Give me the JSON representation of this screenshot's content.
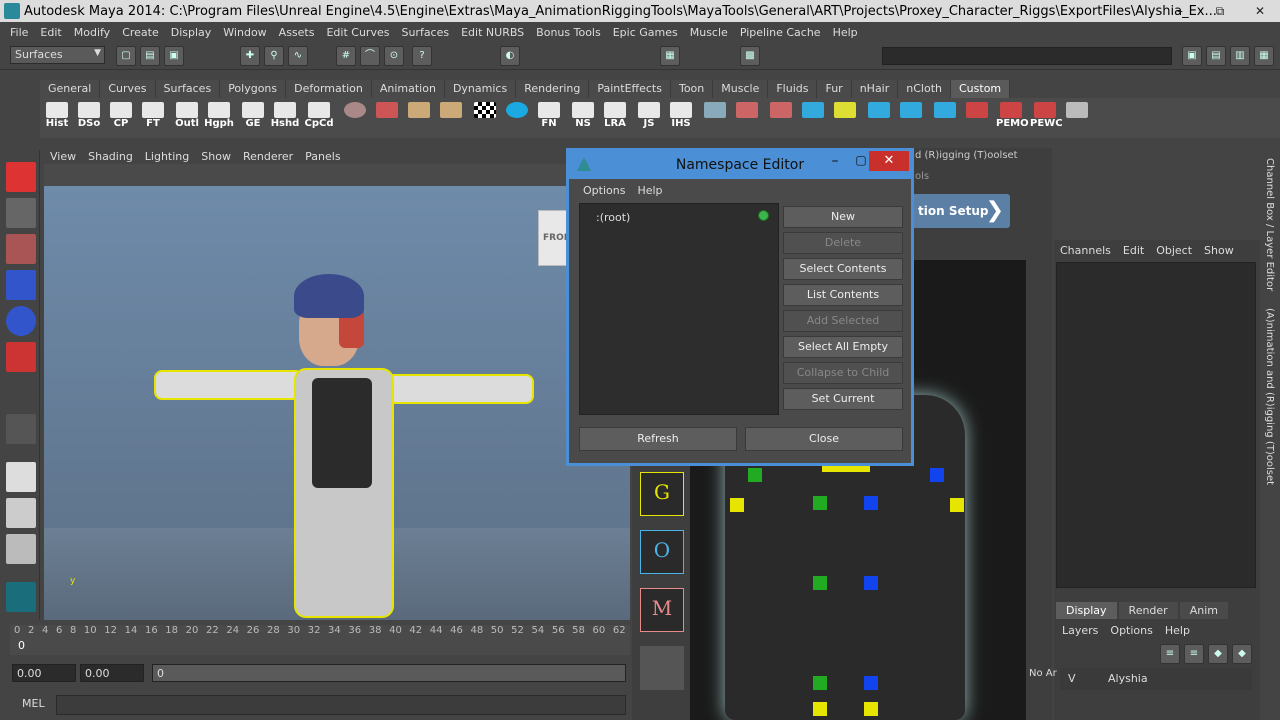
{
  "window": {
    "title": "Autodesk Maya 2014: C:\\Program Files\\Unreal Engine\\4.5\\Engine\\Extras\\Maya_AnimationRiggingTools\\MayaTools\\General\\ART\\Projects\\Proxey_Character_Riggs\\ExportFiles\\Alyshia_Ex...",
    "minimize": "–",
    "restore": "⧉",
    "close": "✕"
  },
  "menubar": [
    "File",
    "Edit",
    "Modify",
    "Create",
    "Display",
    "Window",
    "Assets",
    "Edit Curves",
    "Surfaces",
    "Edit NURBS",
    "Bonus Tools",
    "Epic Games",
    "Muscle",
    "Pipeline Cache",
    "Help"
  ],
  "statusline": {
    "mode": "Surfaces"
  },
  "shelf_tabs": [
    "General",
    "Curves",
    "Surfaces",
    "Polygons",
    "Deformation",
    "Animation",
    "Dynamics",
    "Rendering",
    "PaintEffects",
    "Toon",
    "Muscle",
    "Fluids",
    "Fur",
    "nHair",
    "nCloth",
    "Custom"
  ],
  "shelf_active_tab": "Custom",
  "shelf_buttons": [
    "Hist",
    "DSo",
    "CP",
    "FT",
    "Outl",
    "Hgph",
    "GE",
    "Hshd",
    "CpCd",
    "",
    "",
    "",
    "",
    "",
    "FN",
    "NS",
    "LRA",
    "JS",
    "IHS",
    "",
    "",
    "",
    "",
    "",
    "",
    "",
    "",
    "PEMO",
    "PEWC"
  ],
  "viewport": {
    "menu": [
      "View",
      "Shading",
      "Lighting",
      "Show",
      "Renderer",
      "Panels"
    ],
    "viewcube_label": "FRON",
    "axis_label": "y"
  },
  "timeline": {
    "ticks": [
      "0",
      "2",
      "4",
      "6",
      "8",
      "10",
      "12",
      "14",
      "16",
      "18",
      "20",
      "22",
      "24",
      "26",
      "28",
      "30",
      "32",
      "34",
      "36",
      "38",
      "40",
      "42",
      "44",
      "46",
      "48",
      "50",
      "52",
      "54",
      "56",
      "58",
      "60",
      "62"
    ],
    "current_frame": "0",
    "range_start": "0.00",
    "range_field2": "0.00",
    "range_field3": "0"
  },
  "command_line": {
    "label": "MEL"
  },
  "art_toolset": {
    "title": "d (R)igging (T)oolset",
    "subtitle": "ols",
    "setup_button": "tion Setup",
    "side_buttons": [
      "G",
      "O",
      "M"
    ]
  },
  "channel_box": {
    "menu": [
      "Channels",
      "Edit",
      "Object",
      "Show"
    ],
    "layer_tabs": [
      "Display",
      "Render",
      "Anim"
    ],
    "layer_menu": [
      "Layers",
      "Options",
      "Help"
    ],
    "layer_visibility": "V",
    "layer_name": "Alyshia",
    "left_label": "No Ar"
  },
  "right_tabs": {
    "channel_box_tab": "Channel Box / Layer Editor",
    "art_tab": "(A)nimation and (R)igging (T)oolset"
  },
  "namespace_editor": {
    "title": "Namespace Editor",
    "menu": [
      "Options",
      "Help"
    ],
    "root_item": ":(root)",
    "buttons": [
      {
        "label": "New",
        "enabled": true
      },
      {
        "label": "Delete",
        "enabled": false
      },
      {
        "label": "Select Contents",
        "enabled": true
      },
      {
        "label": "List Contents",
        "enabled": true
      },
      {
        "label": "Add Selected",
        "enabled": false
      },
      {
        "label": "Select All Empty",
        "enabled": true
      },
      {
        "label": "Collapse to Child",
        "enabled": false
      },
      {
        "label": "Set Current",
        "enabled": true
      }
    ],
    "refresh_label": "Refresh",
    "close_label": "Close",
    "status_dot_color": "#3cb44b",
    "title_bar_color": "#4b8fd6",
    "close_btn_color": "#c9302c"
  },
  "colors": {
    "ui_bg": "#444444",
    "selection_yellow": "#e5e500",
    "control_green": "#22aa22",
    "control_blue": "#1144ee"
  }
}
